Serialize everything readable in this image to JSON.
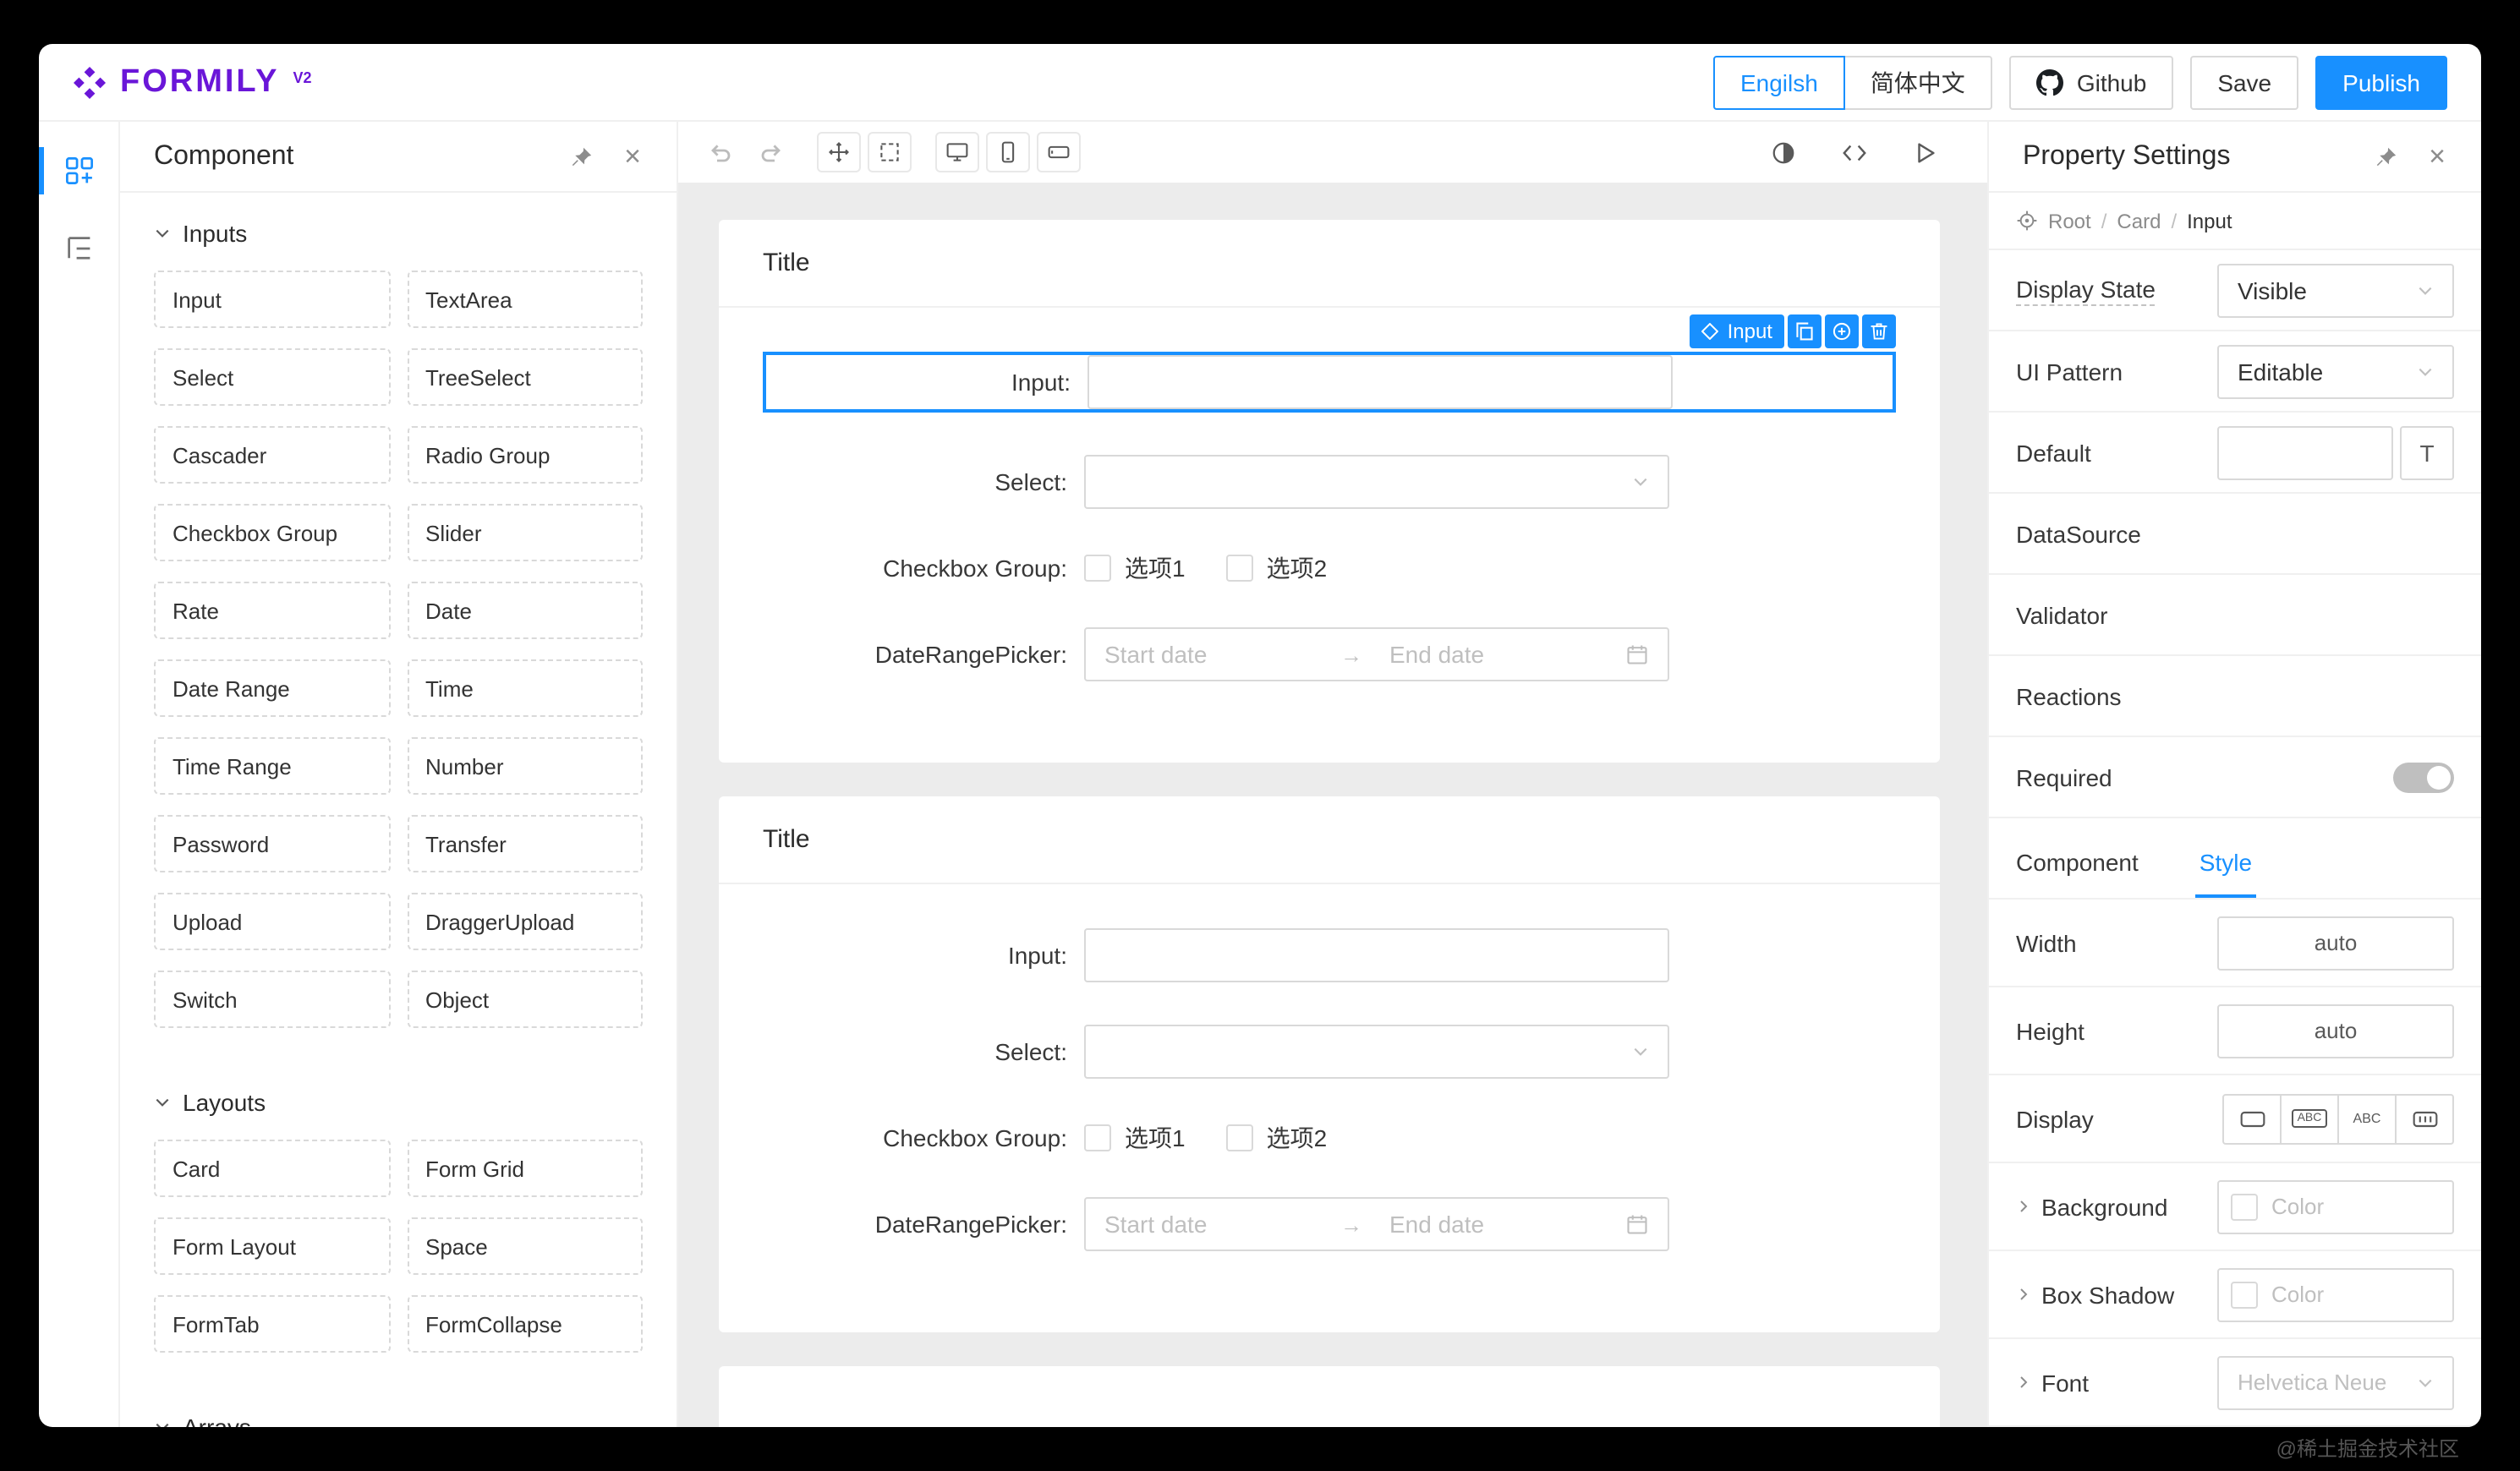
{
  "header": {
    "logo": {
      "text": "Formily",
      "version": "V2"
    },
    "buttons": {
      "english": "Engilsh",
      "chinese": "简体中文",
      "github": "Github",
      "save": "Save",
      "publish": "Publish"
    }
  },
  "componentPanel": {
    "title": "Component",
    "sections": [
      {
        "label": "Inputs",
        "items": [
          "Input",
          "TextArea",
          "Select",
          "TreeSelect",
          "Cascader",
          "Radio Group",
          "Checkbox Group",
          "Slider",
          "Rate",
          "Date",
          "Date Range",
          "Time",
          "Time Range",
          "Number",
          "Password",
          "Transfer",
          "Upload",
          "DraggerUpload",
          "Switch",
          "Object"
        ]
      },
      {
        "label": "Layouts",
        "items": [
          "Card",
          "Form Grid",
          "Form Layout",
          "Space",
          "FormTab",
          "FormCollapse"
        ]
      },
      {
        "label": "Arrays",
        "items": []
      }
    ]
  },
  "canvas": {
    "cards": [
      {
        "title": "Title"
      },
      {
        "title": "Title"
      }
    ],
    "selection": {
      "tag": "Input"
    },
    "form": {
      "labels": {
        "input": "Input:",
        "select": "Select:",
        "checkbox": "Checkbox Group:",
        "dateRange": "DateRangePicker:"
      },
      "checkboxOptions": [
        "选项1",
        "选项2"
      ],
      "dateRange": {
        "start": "Start date",
        "end": "End date"
      }
    }
  },
  "propertyPanel": {
    "title": "Property Settings",
    "breadcrumb": {
      "items": [
        "Root",
        "Card",
        "Input"
      ],
      "separator": "/"
    },
    "rows": {
      "displayState": {
        "label": "Display State",
        "value": "Visible"
      },
      "uiPattern": {
        "label": "UI Pattern",
        "value": "Editable"
      },
      "defaultField": {
        "label": "Default",
        "value": ""
      },
      "dataSource": {
        "label": "DataSource"
      },
      "validator": {
        "label": "Validator"
      },
      "reactions": {
        "label": "Reactions"
      },
      "required": {
        "label": "Required"
      }
    },
    "tabs": {
      "component": "Component",
      "style": "Style"
    },
    "styleRows": {
      "width": {
        "label": "Width",
        "value": "auto"
      },
      "height": {
        "label": "Height",
        "value": "auto"
      },
      "display": {
        "label": "Display"
      },
      "background": {
        "label": "Background",
        "placeholder": "Color"
      },
      "boxShadow": {
        "label": "Box Shadow",
        "placeholder": "Color"
      },
      "font": {
        "label": "Font",
        "placeholder": "Helvetica Neue"
      }
    }
  },
  "icons": {
    "close": "×",
    "textEdit": "T",
    "abc": "ABC",
    "rangeArrow": "→"
  },
  "colors": {
    "accent": "#1890ff",
    "brand": "#6a16d8",
    "canvasBg": "#ececec"
  },
  "watermark": "@稀土掘金技术社区"
}
